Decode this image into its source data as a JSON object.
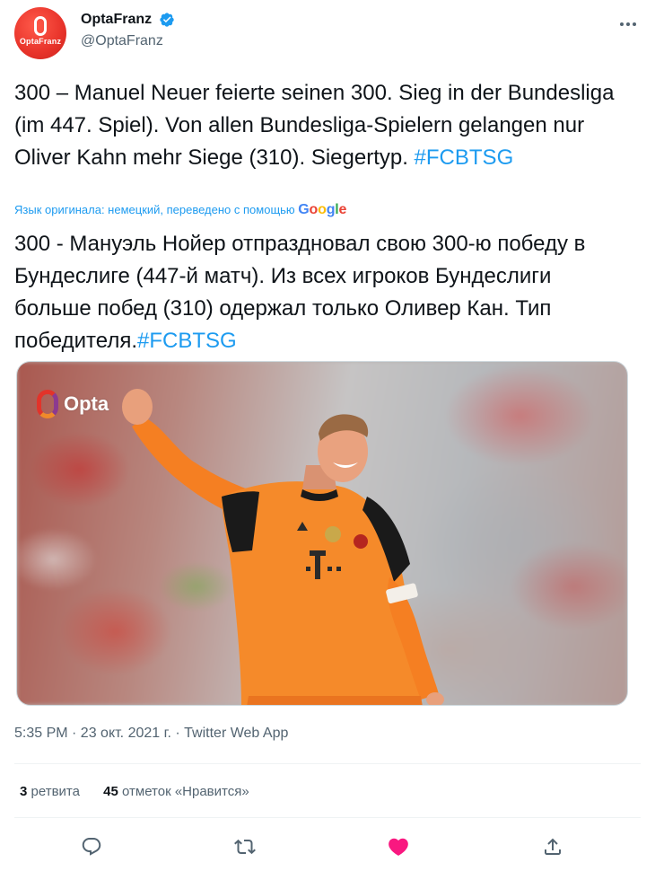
{
  "author": {
    "display_name": "OptaFranz",
    "handle": "@OptaFranz",
    "avatar_text": "OptaFranz",
    "verified": true
  },
  "tweet": {
    "text_de": "300 – Manuel Neuer feierte seinen 300. Sieg in der Bundesliga (im 447. Spiel). Von allen Bundesliga-Spielern gelangen nur Oliver Kahn mehr Siege (310). Siegertyp. ",
    "hashtag_de": "#FCBTSG",
    "translation_notice": "Язык оригинала: немецкий, переведено с помощью ",
    "translation_provider": "Google",
    "text_ru": "300 - Мануэль Нойер отпраздновал свою 300-ю победу в Бундеслиге (447-й матч). Из всех игроков Бундеслиги больше побед (310) одержал только Оливер Кан. Тип победителя.",
    "hashtag_ru": "#FCBTSG"
  },
  "media": {
    "watermark": "Opta"
  },
  "meta": {
    "timestamp": "5:35 PM · 23 окт. 2021 г. · Twitter Web App"
  },
  "stats": {
    "retweets_count": "3",
    "retweets_label": "ретвита",
    "likes_count": "45",
    "likes_label": "отметок «Нравится»"
  },
  "colors": {
    "accent": "#1d9bf0",
    "like": "#f91880",
    "muted": "#536471"
  },
  "icons": {
    "verified": "verified-badge-icon",
    "more": "more-dots-icon",
    "reply": "reply-icon",
    "retweet": "retweet-icon",
    "like": "heart-icon",
    "share": "share-icon"
  }
}
